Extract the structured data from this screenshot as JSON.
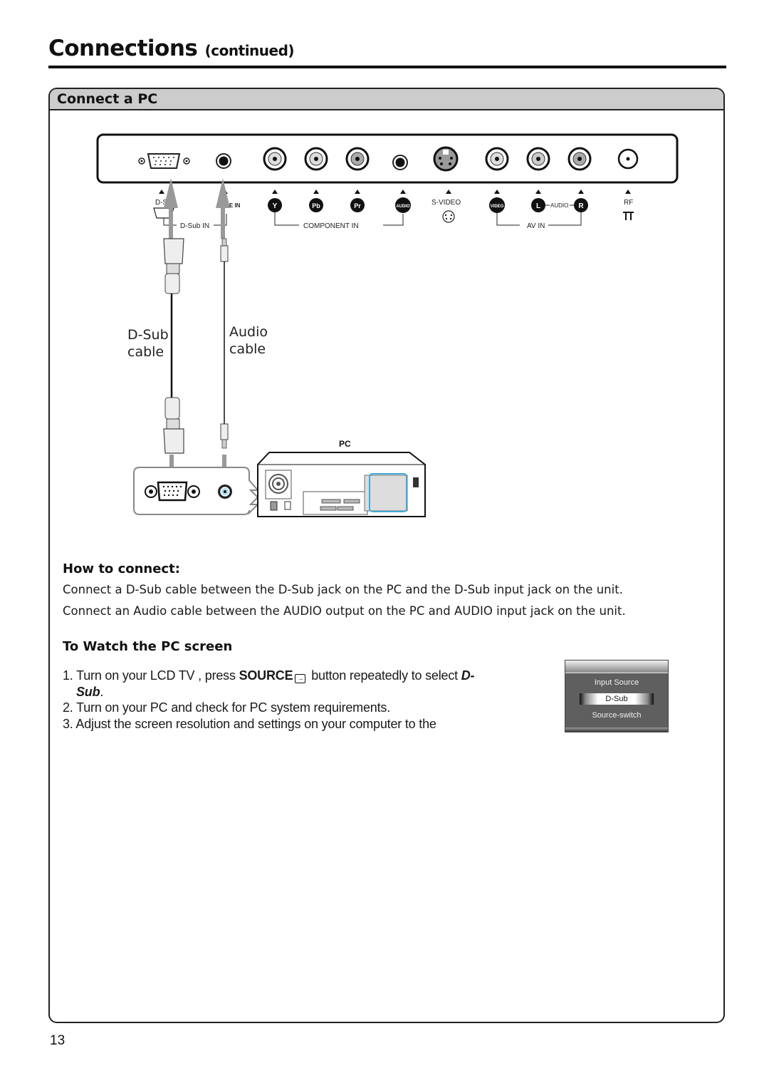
{
  "page": {
    "title": "Connections",
    "title_suffix": "(continued)",
    "page_number": "13"
  },
  "section": {
    "header": "Connect a PC"
  },
  "diagram": {
    "panel_ports": [
      {
        "label": "D-Sub",
        "icon": "vga-port-icon"
      },
      {
        "label": "LINE IN",
        "icon": "minijack-port-icon"
      },
      {
        "label": "Y",
        "icon": "rca-port-icon"
      },
      {
        "label": "Pb",
        "icon": "rca-port-icon"
      },
      {
        "label": "Pr",
        "icon": "rca-port-icon"
      },
      {
        "label": "AUDIO",
        "icon": "minijack-port-icon"
      },
      {
        "label": "S-VIDEO",
        "icon": "svideo-port-icon"
      },
      {
        "label": "VIDEO",
        "icon": "rca-port-icon"
      },
      {
        "label": "L",
        "icon": "rca-port-icon"
      },
      {
        "label": "R",
        "icon": "rca-port-icon"
      },
      {
        "label": "RF",
        "icon": "coax-port-icon"
      }
    ],
    "group_labels": {
      "dsub_in": "D-Sub IN",
      "component_in": "COMPONENT IN",
      "audio": "AUDIO",
      "av_in": "AV IN"
    },
    "cables": {
      "dsub_line1": "D-Sub",
      "dsub_line2": "cable",
      "audio_line1": "Audio",
      "audio_line2": "cable"
    },
    "pc_label": "PC"
  },
  "how_to_connect": {
    "heading": "How to connect:",
    "lines": [
      "Connect a D-Sub cable between the D-Sub  jack on the PC and the D-Sub input jack on the unit.",
      "Connect an Audio cable between  the AUDIO output on the PC and AUDIO input jack on the unit."
    ]
  },
  "watch_pc": {
    "heading": "To Watch the PC screen",
    "step1_prefix": "1. Turn on your LCD TV , press ",
    "step1_bold": "SOURCE",
    "step1_icon": "source-input-icon",
    "step1_middle": " button repeatedly to select ",
    "step1_emph_a": "D-",
    "step1_emph_b": "Sub",
    "step1_end": ".",
    "step2": "2. Turn on your PC and check for PC system requirements.",
    "step3": "3. Adjust the screen resolution and settings on your computer to the"
  },
  "osd_menu": {
    "title": "Input Source",
    "selected": "D-Sub",
    "footer": "Source-switch"
  }
}
